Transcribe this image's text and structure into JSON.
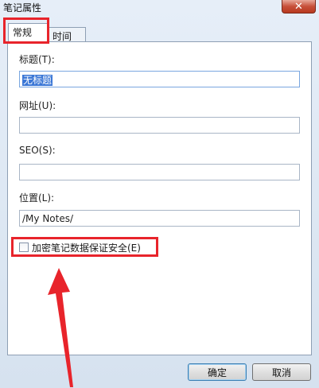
{
  "window": {
    "title": "笔记属性",
    "close_glyph": "✕"
  },
  "tabs": [
    {
      "label": "常规",
      "active": true
    },
    {
      "label": "时间",
      "active": false
    }
  ],
  "fields": {
    "title": {
      "label": "标题(T):",
      "value": "无标题"
    },
    "url": {
      "label": "网址(U):",
      "value": ""
    },
    "seo": {
      "label": "SEO(S):",
      "value": ""
    },
    "location": {
      "label": "位置(L):",
      "value": "/My Notes/"
    }
  },
  "encrypt": {
    "label": "加密笔记数据保证安全(E)",
    "checked": false
  },
  "buttons": {
    "ok": "确定",
    "cancel": "取消"
  },
  "colors": {
    "highlight": "#e8242b",
    "selection": "#3b77d6"
  }
}
